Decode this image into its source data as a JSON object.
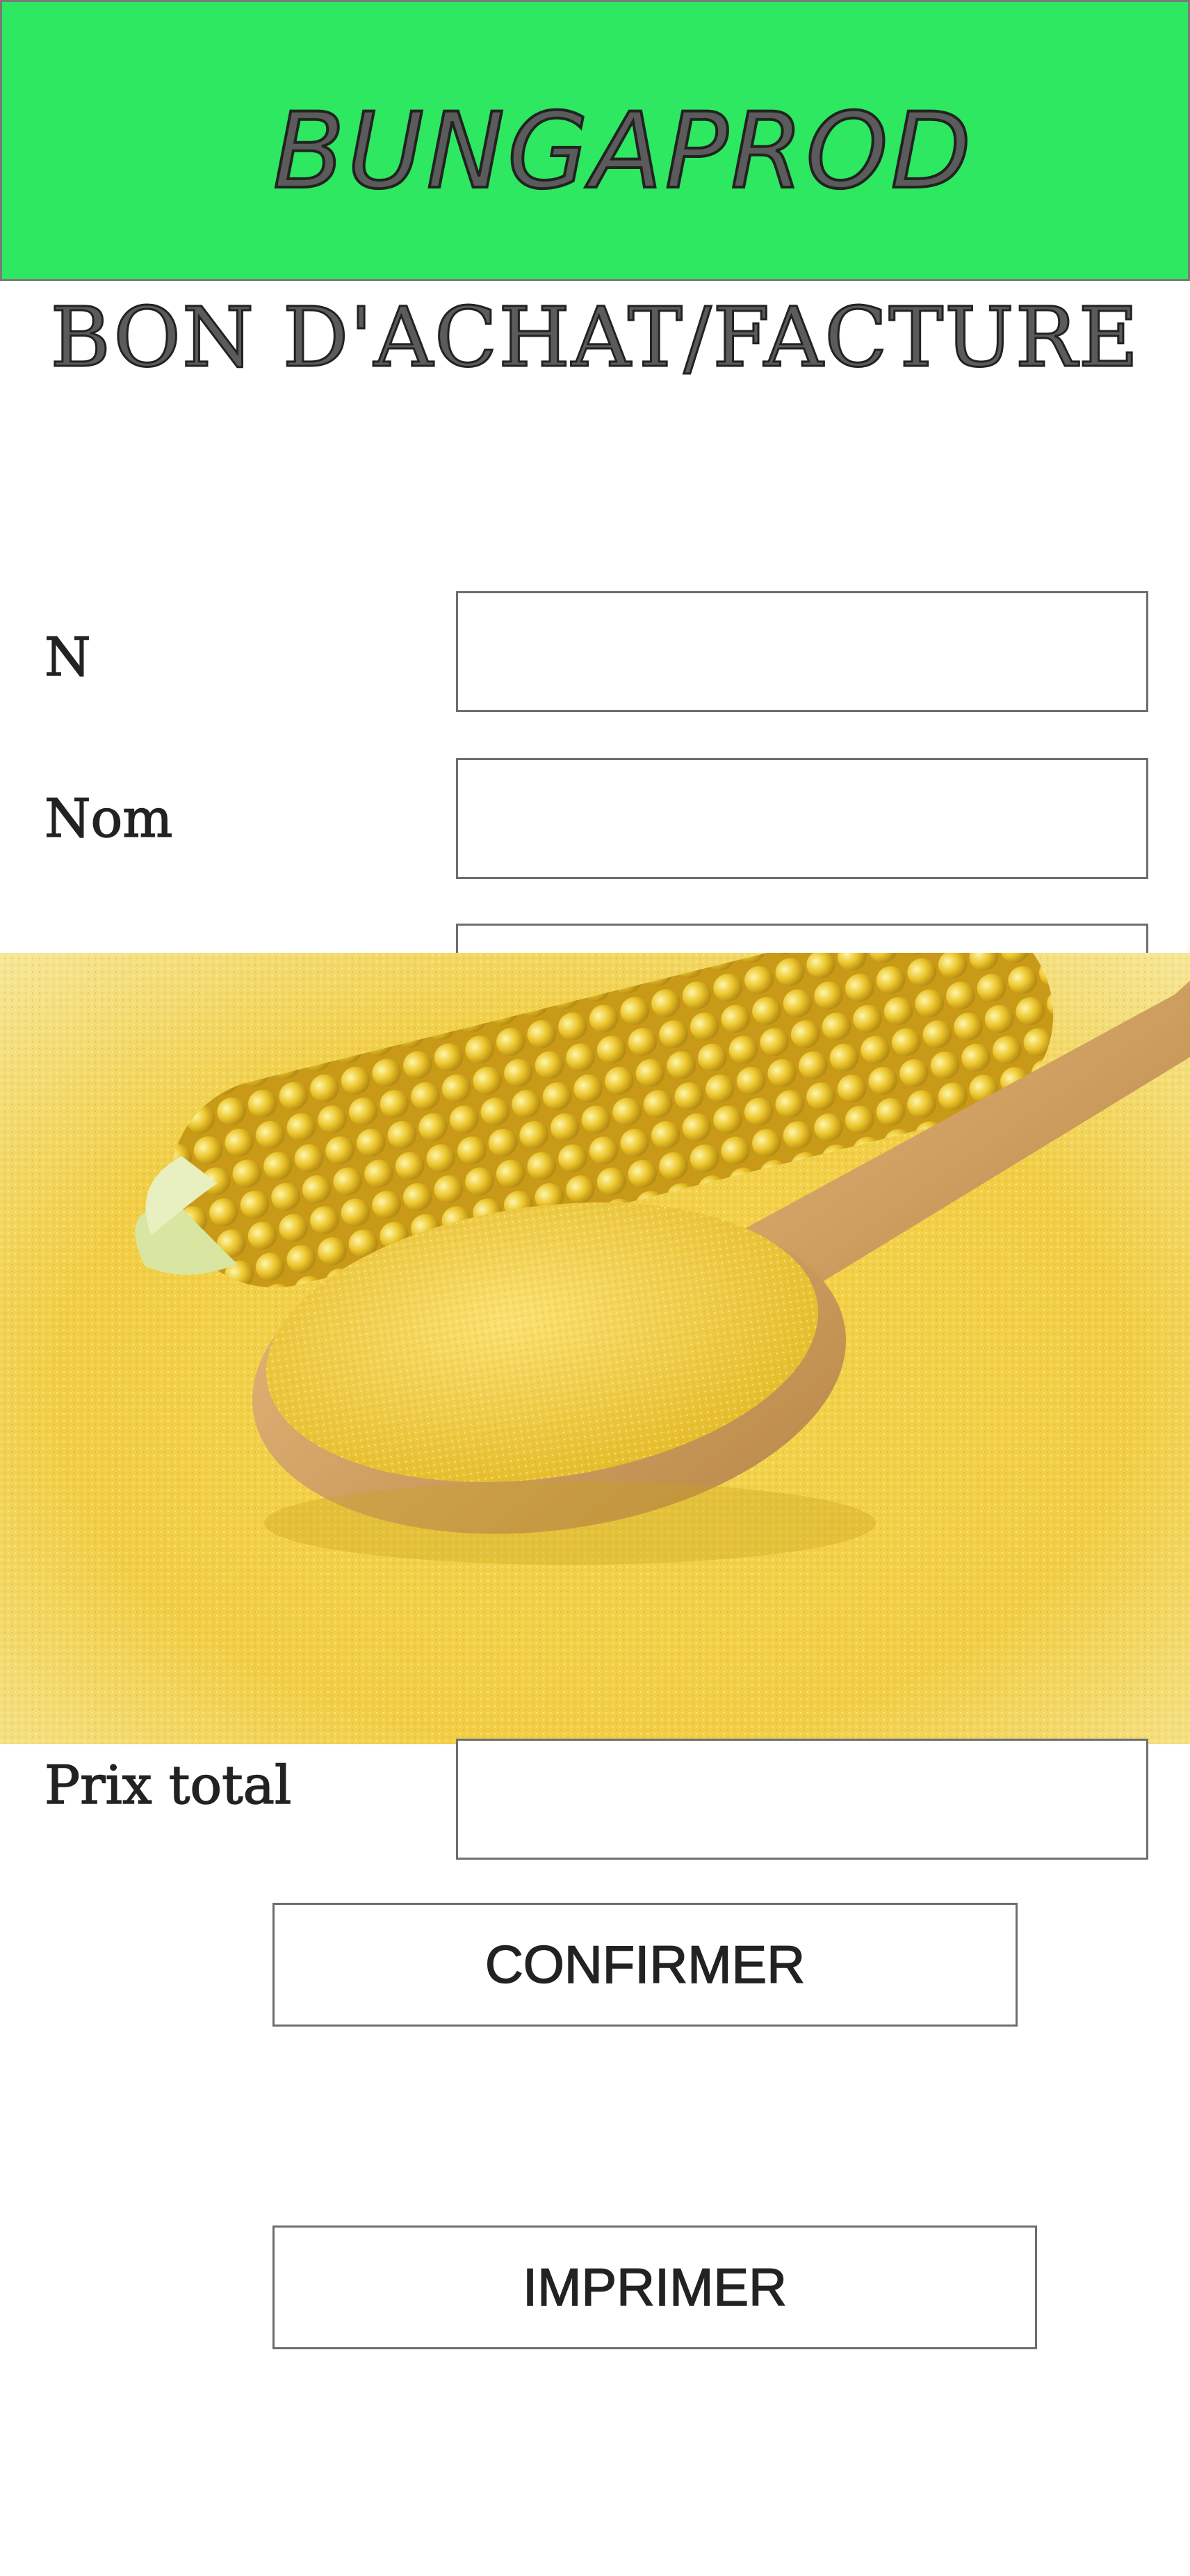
{
  "header": {
    "brand": "BUNGAPROD",
    "title": "BON D'ACHAT/FACTURE"
  },
  "colors": {
    "banner": "#2de860",
    "border": "#6e6e6e",
    "text": "#222222"
  },
  "form": {
    "fields": [
      {
        "label": "N",
        "value": ""
      },
      {
        "label": "Nom",
        "value": ""
      },
      {
        "label": "Prix total",
        "value": ""
      }
    ]
  },
  "actions": {
    "confirm_label": "CONFIRMER",
    "print_label": "IMPRIMER"
  },
  "image": {
    "subject": "corn-cob-and-cornmeal-spoon"
  }
}
